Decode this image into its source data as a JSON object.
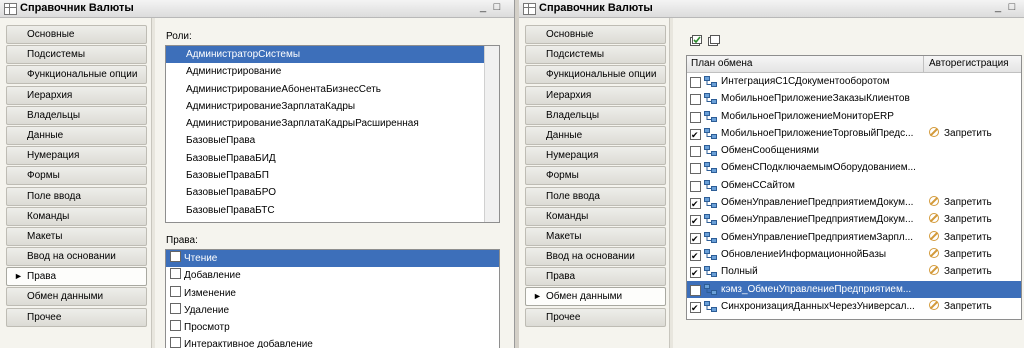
{
  "left": {
    "title": "Справочник Валюты",
    "nav": [
      "Основные",
      "Подсистемы",
      "Функциональные опции",
      "Иерархия",
      "Владельцы",
      "Данные",
      "Нумерация",
      "Формы",
      "Поле ввода",
      "Команды",
      "Макеты",
      "Ввод на основании",
      "Права",
      "Обмен данными",
      "Прочее"
    ],
    "roles_label": "Роли:",
    "roles": [
      "АдминистраторСистемы",
      "Администрирование",
      "АдминистрированиеАбонентаБизнесСеть",
      "АдминистрированиеЗарплатаКадры",
      "АдминистрированиеЗарплатаКадрыРасширенная",
      "БазовыеПрава",
      "БазовыеПраваБИД",
      "БазовыеПраваБП",
      "БазовыеПраваБРО",
      "БазовыеПраваБТС"
    ],
    "rights_label": "Права:",
    "rights": [
      "Чтение",
      "Добавление",
      "Изменение",
      "Удаление",
      "Просмотр",
      "Интерактивное добавление"
    ]
  },
  "right": {
    "title": "Справочник Валюты",
    "nav": [
      "Основные",
      "Подсистемы",
      "Функциональные опции",
      "Иерархия",
      "Владельцы",
      "Данные",
      "Нумерация",
      "Формы",
      "Поле ввода",
      "Команды",
      "Макеты",
      "Ввод на основании",
      "Права",
      "Обмен данными",
      "Прочее"
    ],
    "col_plan": "План обмена",
    "col_auto": "Авторегистрация",
    "rows": [
      {
        "name": "ИнтеграцияС1СДокументооборотом",
        "checked": false,
        "auto": ""
      },
      {
        "name": "МобильноеПриложениеЗаказыКлиентов",
        "checked": false,
        "auto": ""
      },
      {
        "name": "МобильноеПриложениеМониторERP",
        "checked": false,
        "auto": ""
      },
      {
        "name": "МобильноеПриложениеТорговыйПредс...",
        "checked": true,
        "auto": "Запретить"
      },
      {
        "name": "ОбменСообщениями",
        "checked": false,
        "auto": ""
      },
      {
        "name": "ОбменСПодключаемымОборудованием...",
        "checked": false,
        "auto": ""
      },
      {
        "name": "ОбменССайтом",
        "checked": false,
        "auto": ""
      },
      {
        "name": "ОбменУправлениеПредприятиемДокум...",
        "checked": true,
        "auto": "Запретить"
      },
      {
        "name": "ОбменУправлениеПредприятиемДокум...",
        "checked": true,
        "auto": "Запретить"
      },
      {
        "name": "ОбменУправлениеПредприятиемЗарпл...",
        "checked": true,
        "auto": "Запретить"
      },
      {
        "name": "ОбновлениеИнформационнойБазы",
        "checked": true,
        "auto": "Запретить"
      },
      {
        "name": "Полный",
        "checked": true,
        "auto": "Запретить"
      },
      {
        "name": "кэмз_ОбменУправлениеПредприятием...",
        "checked": false,
        "auto": ""
      },
      {
        "name": "СинхронизацияДанныхЧерезУниверсал...",
        "checked": true,
        "auto": "Запретить"
      }
    ]
  }
}
